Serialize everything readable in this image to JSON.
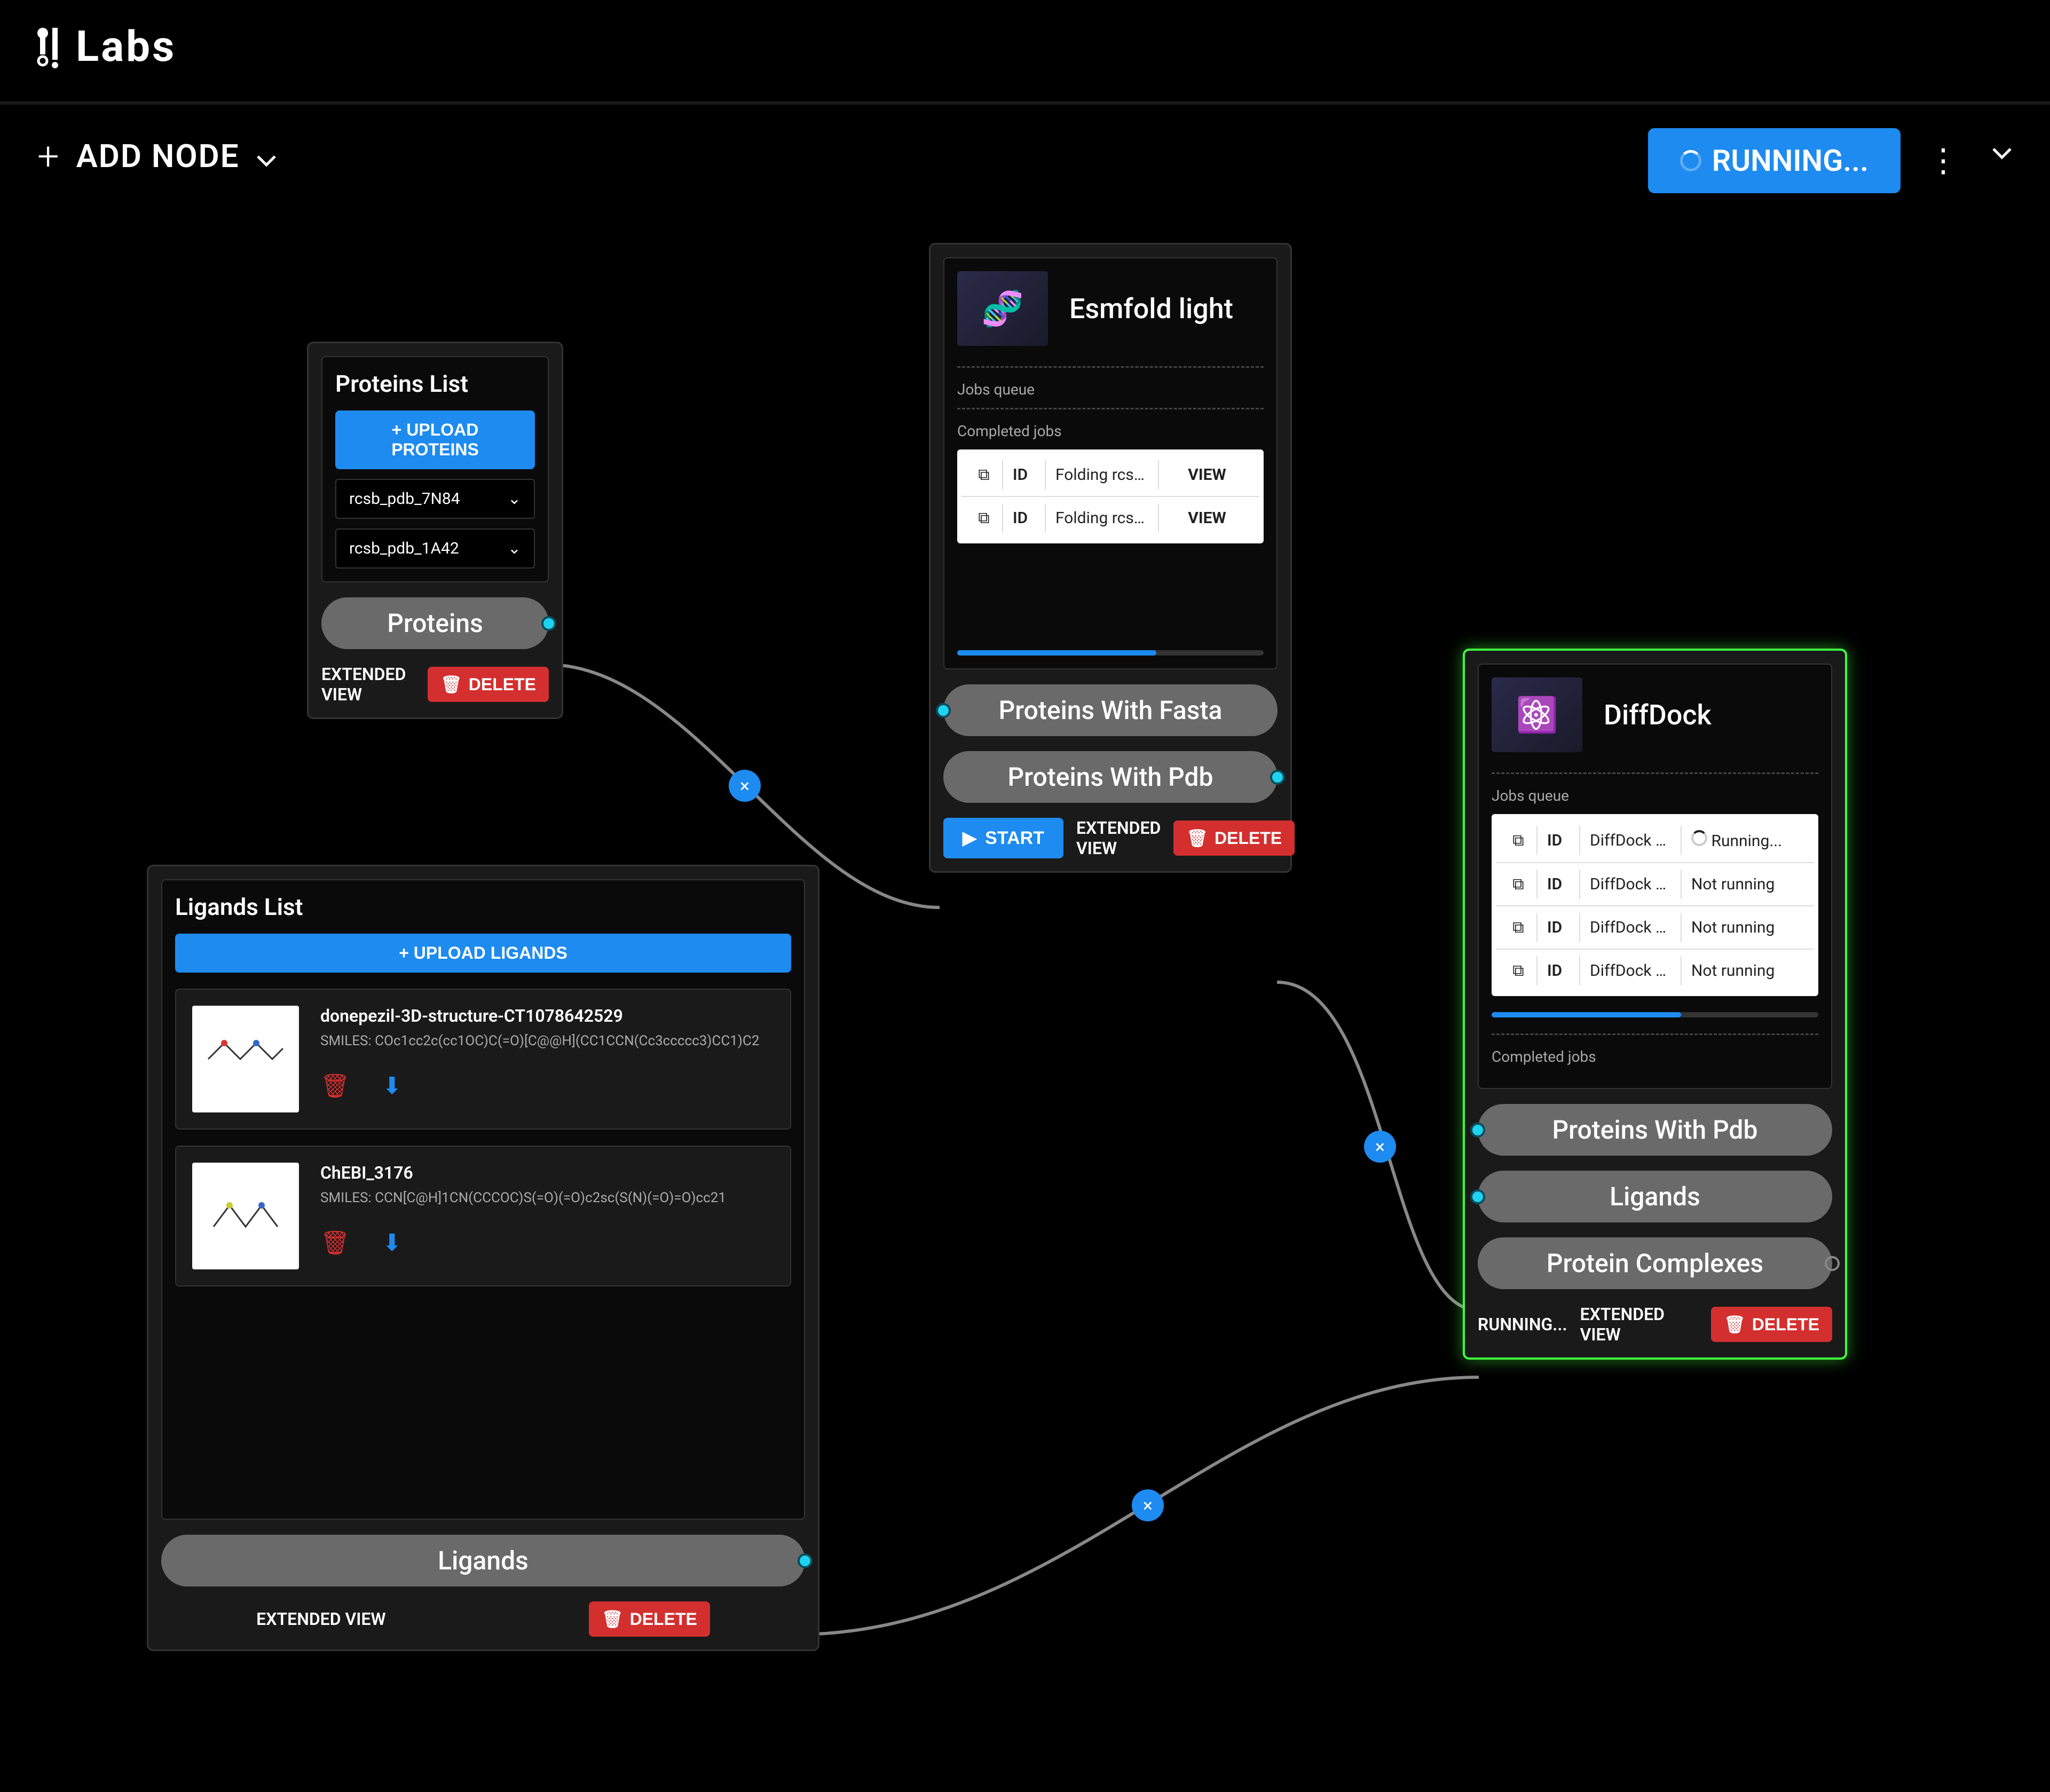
{
  "brand": "Labs",
  "toolbar": {
    "add_node": "ADD NODE",
    "running": "RUNNING..."
  },
  "proteins_node": {
    "title": "Proteins List",
    "upload_btn": "+ UPLOAD PROTEINS",
    "items": [
      "rcsb_pdb_7N84",
      "rcsb_pdb_1A42"
    ],
    "port": "Proteins",
    "extended_view": "EXTENDED VIEW",
    "delete": "DELETE"
  },
  "ligands_node": {
    "title": "Ligands List",
    "upload_btn": "+ UPLOAD LIGANDS",
    "ligands": [
      {
        "name": "donepezil-3D-structure-CT1078642529",
        "smiles": "SMILES: COc1cc2c(cc1OC)C(=O)[C@@H](CC1CCN(Cc3ccccc3)CC1)C2"
      },
      {
        "name": "ChEBI_3176",
        "smiles": "SMILES: CCN[C@H]1CN(CCCOC)S(=O)(=O)c2sc(S(N)(=O)=O)cc21"
      }
    ],
    "port": "Ligands",
    "extended_view": "EXTENDED VIEW",
    "delete": "DELETE"
  },
  "esmfold_node": {
    "title": "Esmfold light",
    "jobs_queue_label": "Jobs queue",
    "completed_label": "Completed jobs",
    "id_col": "ID",
    "completed": [
      {
        "name": "Folding rcsb...",
        "action": "VIEW"
      },
      {
        "name": "Folding rcsb...",
        "action": "VIEW"
      }
    ],
    "port_fasta": "Proteins With Fasta",
    "port_pdb": "Proteins With Pdb",
    "start": "START",
    "extended_view": "EXTENDED VIEW",
    "delete": "DELETE"
  },
  "diffdock_node": {
    "title": "DiffDock",
    "jobs_queue_label": "Jobs queue",
    "completed_label": "Completed jobs",
    "id_col": "ID",
    "queue": [
      {
        "name": "DiffDock rc...",
        "status": "Running..."
      },
      {
        "name": "DiffDock rc...",
        "status": "Not running"
      },
      {
        "name": "DiffDock rc...",
        "status": "Not running"
      },
      {
        "name": "DiffDock rc...",
        "status": "Not running"
      }
    ],
    "port_pdb": "Proteins With Pdb",
    "port_ligands": "Ligands",
    "port_complexes": "Protein Complexes",
    "running": "RUNNING...",
    "extended_view": "EXTENDED VIEW",
    "delete": "DELETE"
  }
}
